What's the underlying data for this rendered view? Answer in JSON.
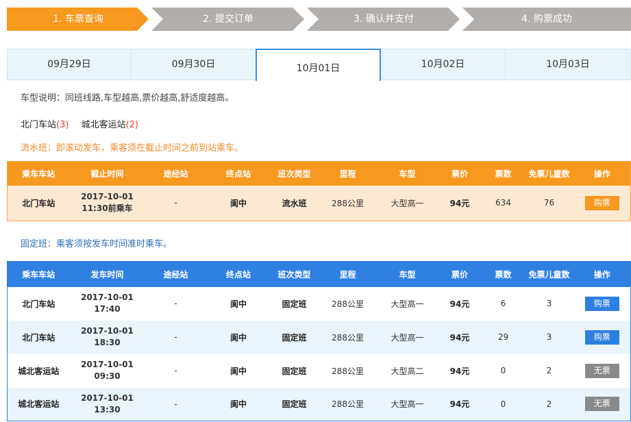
{
  "steps": [
    {
      "label": "1. 车票查询",
      "color": "#f7981f"
    },
    {
      "label": "2. 提交订单",
      "color": "#b1aeab"
    },
    {
      "label": "3. 确认并支付",
      "color": "#b1aeab"
    },
    {
      "label": "4. 购票成功",
      "color": "#b1aeab"
    }
  ],
  "dates": [
    "09月29日",
    "09月30日",
    "10月01日",
    "10月02日",
    "10月03日"
  ],
  "active_date": "10月01日",
  "notes": {
    "type_desc": "车型说明：同班线路,车型越高,票价越高,舒适度越高。",
    "flow": "流水班：即滚动发车，乘客须在截止时间之前到站乘车。",
    "fixed": "固定班：乘客须按发车时间准时乘车。"
  },
  "stations": [
    {
      "name": "北门车站",
      "count": "(3)"
    },
    {
      "name": "城北客运站",
      "count": "(2)"
    }
  ],
  "flow_table": {
    "headers": [
      "乘车车站",
      "截止时间",
      "途经站",
      "终点站",
      "班次类型",
      "里程",
      "车型",
      "票价",
      "票数",
      "免票儿童数",
      "操作"
    ],
    "rows": [
      {
        "station": "北门车站",
        "date": "2017-10-01",
        "time": "11:30前乘车",
        "via": "-",
        "dest": "阆中",
        "type": "流水班",
        "distance": "288公里",
        "vehicle": "大型高一",
        "price": "94元",
        "tickets": "634",
        "children": "76",
        "action": "购票"
      }
    ]
  },
  "fixed_table": {
    "headers": [
      "乘车车站",
      "发车时间",
      "途经站",
      "终点站",
      "班次类型",
      "里程",
      "车型",
      "票价",
      "票数",
      "免票儿童数",
      "操作"
    ],
    "rows": [
      {
        "station": "北门车站",
        "date": "2017-10-01",
        "time": "17:40",
        "via": "-",
        "dest": "阆中",
        "type": "固定班",
        "distance": "288公里",
        "vehicle": "大型高一",
        "price": "94元",
        "tickets": "6",
        "children": "3",
        "action": "购票",
        "available": true
      },
      {
        "station": "北门车站",
        "date": "2017-10-01",
        "time": "18:30",
        "via": "-",
        "dest": "阆中",
        "type": "固定班",
        "distance": "288公里",
        "vehicle": "大型高一",
        "price": "94元",
        "tickets": "29",
        "children": "3",
        "action": "购票",
        "available": true
      },
      {
        "station": "城北客运站",
        "date": "2017-10-01",
        "time": "09:30",
        "via": "-",
        "dest": "阆中",
        "type": "固定班",
        "distance": "288公里",
        "vehicle": "大型高二",
        "price": "94元",
        "tickets": "0",
        "children": "2",
        "action": "无票",
        "available": false
      },
      {
        "station": "城北客运站",
        "date": "2017-10-01",
        "time": "13:30",
        "via": "-",
        "dest": "阆中",
        "type": "固定班",
        "distance": "288公里",
        "vehicle": "大型高一",
        "price": "94元",
        "tickets": "0",
        "children": "2",
        "action": "无票",
        "available": false
      }
    ]
  }
}
